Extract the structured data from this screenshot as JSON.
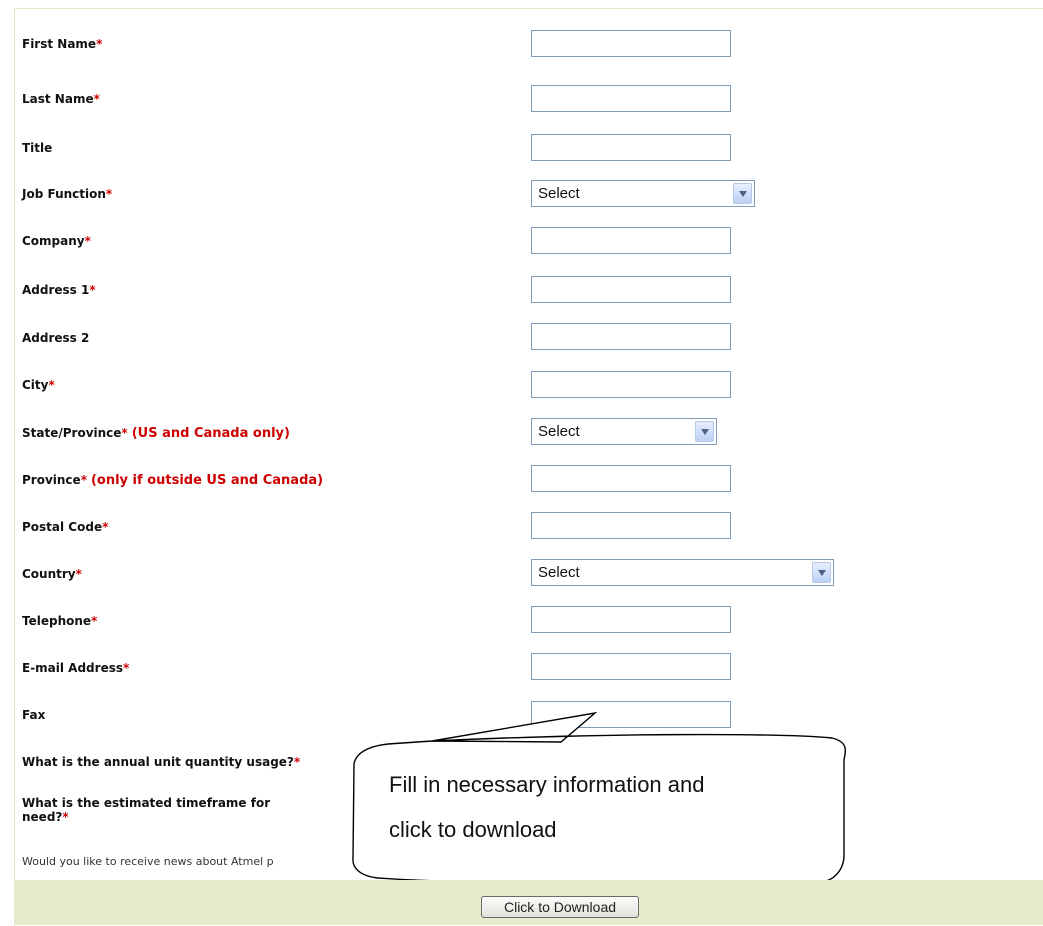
{
  "form": {
    "fields": [
      {
        "label": "First Name",
        "required": true,
        "note": "",
        "type": "text"
      },
      {
        "label": "Last Name",
        "required": true,
        "note": "",
        "type": "text"
      },
      {
        "label": "Title",
        "required": false,
        "note": "",
        "type": "text"
      },
      {
        "label": "Job Function",
        "required": true,
        "note": "",
        "type": "select",
        "selected": "Select"
      },
      {
        "label": "Company",
        "required": true,
        "note": "",
        "type": "text"
      },
      {
        "label": "Address 1",
        "required": true,
        "note": "",
        "type": "text"
      },
      {
        "label": "Address 2",
        "required": false,
        "note": "",
        "type": "text"
      },
      {
        "label": "City",
        "required": true,
        "note": "",
        "type": "text"
      },
      {
        "label": "State/Province",
        "required": true,
        "note": "(US and Canada only)",
        "type": "select",
        "selected": "Select"
      },
      {
        "label": "Province",
        "required": true,
        "note": "(only if outside US and Canada)",
        "type": "text"
      },
      {
        "label": "Postal Code",
        "required": true,
        "note": "",
        "type": "text"
      },
      {
        "label": "Country",
        "required": true,
        "note": "",
        "type": "select",
        "selected": "Select"
      },
      {
        "label": "Telephone",
        "required": true,
        "note": "",
        "type": "text"
      },
      {
        "label": "E-mail Address",
        "required": true,
        "note": "",
        "type": "text"
      },
      {
        "label": "Fax",
        "required": false,
        "note": "",
        "type": "text"
      }
    ],
    "question_usage": "What is the annual unit quantity usage?",
    "question_timeframe_line1": "What is the estimated timeframe for",
    "question_timeframe_line2": "need?",
    "required_marker": "*",
    "optin_text": "Would you like to receive news about Atmel p",
    "download_button": "Click to Download"
  },
  "callout": {
    "line1": "Fill in necessary information and",
    "line2": "click to download"
  },
  "colors": {
    "required": "#cc0000",
    "bottom_bar": "#e4eccb",
    "input_border": "#7f9db9"
  }
}
